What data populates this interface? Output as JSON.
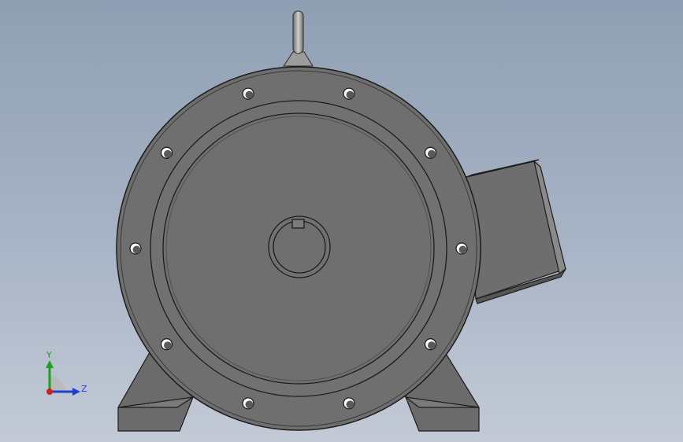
{
  "view": {
    "background_top": "#8f9fb3",
    "background_bottom": "#c3cad6"
  },
  "model": {
    "name": "motor-front-view",
    "body_color": "#6f6f6f",
    "edge_color": "#1c1c1c",
    "highlight_color": "#a8a8a8",
    "bolt_hole_count": 10
  },
  "triad": {
    "y_label": "Y",
    "z_label": "Z",
    "y_color": "#1aa31a",
    "z_color": "#1f3fd1",
    "x_color": "#d11f1f"
  }
}
